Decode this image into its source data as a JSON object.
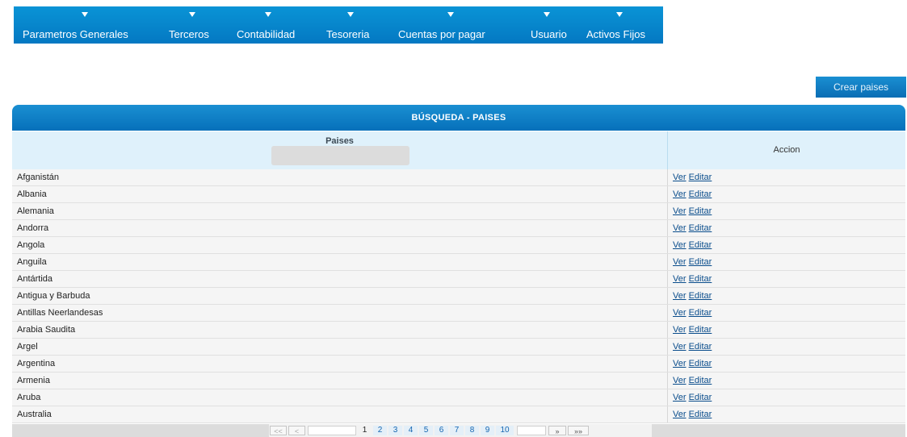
{
  "nav": {
    "items": [
      {
        "label": "Parametros Generales",
        "icon": "caret-down-icon"
      },
      {
        "label": "Terceros",
        "icon": "caret-down-icon"
      },
      {
        "label": "Contabilidad",
        "icon": "caret-down-icon"
      },
      {
        "label": "Tesoreria",
        "icon": "caret-down-icon"
      },
      {
        "label": "Cuentas por pagar",
        "icon": "caret-down-icon"
      },
      {
        "label": "Usuario",
        "icon": "caret-down-icon"
      },
      {
        "label": "Activos Fijos",
        "icon": "caret-down-icon"
      }
    ]
  },
  "actions": {
    "create_label": "Crear paises"
  },
  "panel": {
    "title": "BÚSQUEDA - PAISES",
    "columns": {
      "paises": "Paises",
      "accion": "Accion"
    },
    "filter_value": ""
  },
  "rows": [
    {
      "name": "Afganistán",
      "ver": "Ver",
      "editar": "Editar"
    },
    {
      "name": "Albania",
      "ver": "Ver",
      "editar": "Editar"
    },
    {
      "name": "Alemania",
      "ver": "Ver",
      "editar": "Editar"
    },
    {
      "name": "Andorra",
      "ver": "Ver",
      "editar": "Editar"
    },
    {
      "name": "Angola",
      "ver": "Ver",
      "editar": "Editar"
    },
    {
      "name": "Anguila",
      "ver": "Ver",
      "editar": "Editar"
    },
    {
      "name": "Antártida",
      "ver": "Ver",
      "editar": "Editar"
    },
    {
      "name": "Antigua y Barbuda",
      "ver": "Ver",
      "editar": "Editar"
    },
    {
      "name": "Antillas Neerlandesas",
      "ver": "Ver",
      "editar": "Editar"
    },
    {
      "name": "Arabia Saudita",
      "ver": "Ver",
      "editar": "Editar"
    },
    {
      "name": "Argel",
      "ver": "Ver",
      "editar": "Editar"
    },
    {
      "name": "Argentina",
      "ver": "Ver",
      "editar": "Editar"
    },
    {
      "name": "Armenia",
      "ver": "Ver",
      "editar": "Editar"
    },
    {
      "name": "Aruba",
      "ver": "Ver",
      "editar": "Editar"
    },
    {
      "name": "Australia",
      "ver": "Ver",
      "editar": "Editar"
    }
  ],
  "pager": {
    "first": "<<",
    "prev": "<",
    "next": "»",
    "last": "»»",
    "pages": [
      "1",
      "2",
      "3",
      "4",
      "5",
      "6",
      "7",
      "8",
      "9",
      "10"
    ],
    "current": "1"
  },
  "colors": {
    "accent": "#0a84cc",
    "header_bg": "#dff1fb",
    "row_bg": "#f5f5f5",
    "link": "#0a4d8c"
  }
}
